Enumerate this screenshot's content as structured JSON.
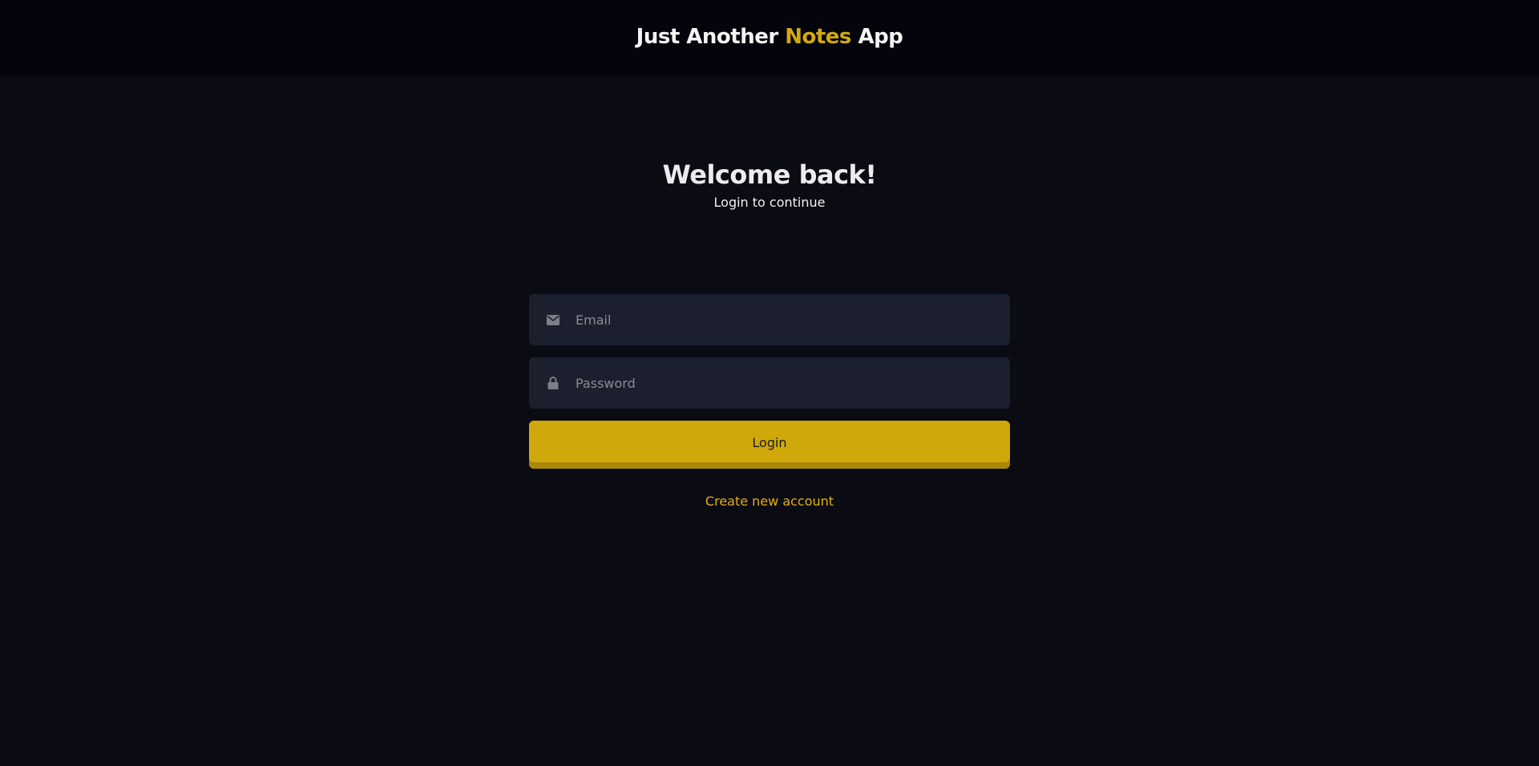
{
  "header": {
    "title_part1": "Just Another",
    "title_accent": "Notes",
    "title_part2": "App"
  },
  "hero": {
    "heading": "Welcome back!",
    "subtitle": "Login to continue"
  },
  "form": {
    "email": {
      "icon": "envelope-icon",
      "placeholder": "Email",
      "value": ""
    },
    "password": {
      "icon": "lock-icon",
      "placeholder": "Password",
      "value": ""
    },
    "submit_label": "Login",
    "create_account_label": "Create new account"
  },
  "colors": {
    "background": "#0b0c13",
    "header_background": "#04050c",
    "accent": "#d4a90e",
    "input_background": "#1c1f2d",
    "button": "#cfa90c",
    "link": "#e2ad17"
  }
}
